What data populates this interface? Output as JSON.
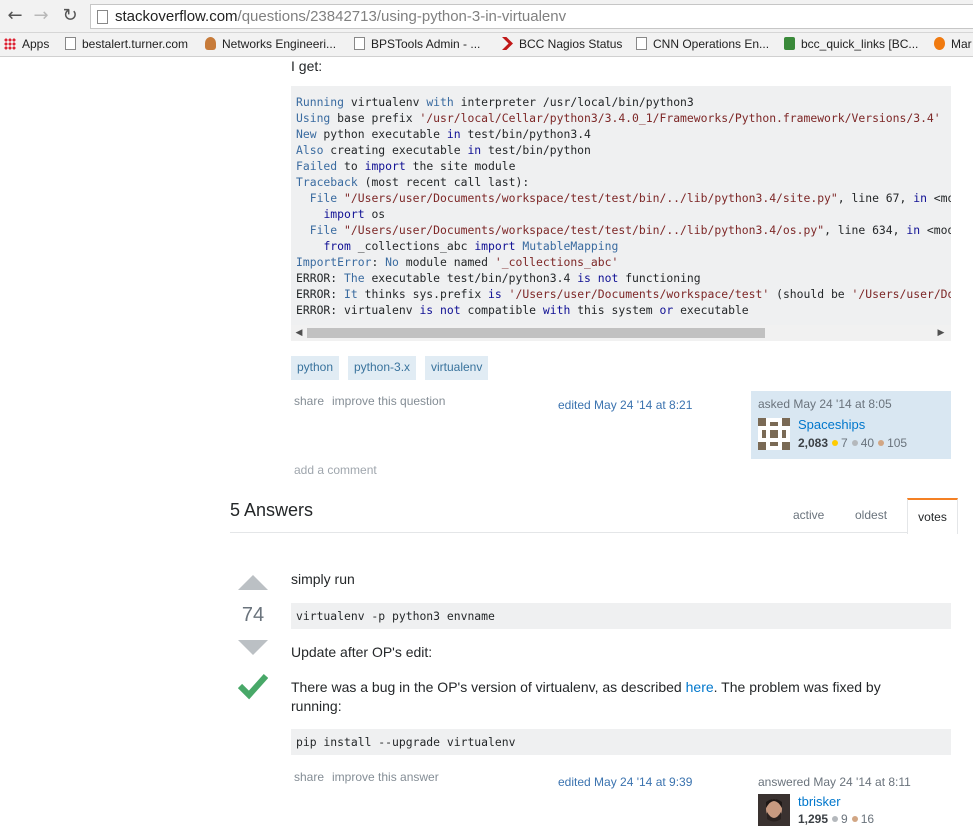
{
  "browser": {
    "url_host": "stackoverflow.com",
    "url_path": "/questions/23842713/using-python-3-in-virtualenv",
    "bookmarks": [
      "Apps",
      "bestalert.turner.com",
      "Networks Engineeri...",
      "BPSTools Admin - ...",
      "BCC Nagios Status",
      "CNN Operations En...",
      "bcc_quick_links [BC...",
      "Mar"
    ]
  },
  "question": {
    "i_get": "I get:",
    "code_lines": [
      [
        [
          "kb",
          "Running"
        ],
        [
          "t",
          " virtualenv "
        ],
        [
          "kb",
          "with"
        ],
        [
          "t",
          " interpreter /usr/local/bin/python3"
        ]
      ],
      [
        [
          "kb",
          "Using"
        ],
        [
          "t",
          " base prefix "
        ],
        [
          "st",
          "'/usr/local/Cellar/python3/3.4.0_1/Frameworks/Python.framework/Versions/3.4'"
        ]
      ],
      [
        [
          "kb",
          "New"
        ],
        [
          "t",
          " python executable "
        ],
        [
          "kw",
          "in"
        ],
        [
          "t",
          " test/bin/python3.4"
        ]
      ],
      [
        [
          "kb",
          "Also"
        ],
        [
          "t",
          " creating executable "
        ],
        [
          "kw",
          "in"
        ],
        [
          "t",
          " test/bin/python"
        ]
      ],
      [
        [
          "kb",
          "Failed"
        ],
        [
          "t",
          " to "
        ],
        [
          "kw",
          "import"
        ],
        [
          "t",
          " the site module"
        ]
      ],
      [
        [
          "kb",
          "Traceback"
        ],
        [
          "t",
          " (most recent call last):"
        ]
      ],
      [
        [
          "t",
          "  "
        ],
        [
          "kb",
          "File"
        ],
        [
          "t",
          " "
        ],
        [
          "st",
          "\"/Users/user/Documents/workspace/test/test/bin/../lib/python3.4/site.py\""
        ],
        [
          "t",
          ", line 67, "
        ],
        [
          "kw",
          "in"
        ],
        [
          "t",
          " <module>"
        ]
      ],
      [
        [
          "t",
          "    "
        ],
        [
          "kw",
          "import"
        ],
        [
          "t",
          " os"
        ]
      ],
      [
        [
          "t",
          "  "
        ],
        [
          "kb",
          "File"
        ],
        [
          "t",
          " "
        ],
        [
          "st",
          "\"/Users/user/Documents/workspace/test/test/bin/../lib/python3.4/os.py\""
        ],
        [
          "t",
          ", line 634, "
        ],
        [
          "kw",
          "in"
        ],
        [
          "t",
          " <module>"
        ]
      ],
      [
        [
          "t",
          "    "
        ],
        [
          "kw",
          "from"
        ],
        [
          "t",
          " _collections_abc "
        ],
        [
          "kw",
          "import"
        ],
        [
          "t",
          " "
        ],
        [
          "kb",
          "MutableMapping"
        ]
      ],
      [
        [
          "kb",
          "ImportError"
        ],
        [
          "t",
          ": "
        ],
        [
          "kb",
          "No"
        ],
        [
          "t",
          " module named "
        ],
        [
          "st",
          "'_collections_abc'"
        ]
      ],
      [
        [
          "t",
          "ERROR: "
        ],
        [
          "kb",
          "The"
        ],
        [
          "t",
          " executable test/bin/python3.4 "
        ],
        [
          "kw",
          "is"
        ],
        [
          "t",
          " "
        ],
        [
          "kw",
          "not"
        ],
        [
          "t",
          " functioning"
        ]
      ],
      [
        [
          "t",
          "ERROR: "
        ],
        [
          "kb",
          "It"
        ],
        [
          "t",
          " thinks sys.prefix "
        ],
        [
          "kw",
          "is"
        ],
        [
          "t",
          " "
        ],
        [
          "st",
          "'/Users/user/Documents/workspace/test'"
        ],
        [
          "t",
          " (should be "
        ],
        [
          "st",
          "'/Users/user/Documents/workspace/test/test'"
        ],
        [
          "t",
          ")"
        ]
      ],
      [
        [
          "t",
          "ERROR: virtualenv "
        ],
        [
          "kw",
          "is"
        ],
        [
          "t",
          " "
        ],
        [
          "kw",
          "not"
        ],
        [
          "t",
          " compatible "
        ],
        [
          "kw",
          "with"
        ],
        [
          "t",
          " this system "
        ],
        [
          "kw",
          "or"
        ],
        [
          "t",
          " executable"
        ]
      ]
    ],
    "tags": [
      "python",
      "python-3.x",
      "virtualenv"
    ],
    "share": "share",
    "improve": "improve this question",
    "edited": "edited May 24 '14 at 8:21",
    "asked": "asked May 24 '14 at 8:05",
    "user": {
      "name": "Spaceships",
      "rep": "2,083",
      "gold": "7",
      "silver": "40",
      "bronze": "105"
    },
    "add_comment": "add a comment"
  },
  "answers_header": {
    "title": "5 Answers",
    "tabs": [
      "active",
      "oldest",
      "votes"
    ]
  },
  "answer": {
    "votes": "74",
    "p1": "simply run",
    "code1": "virtualenv -p python3 envname",
    "p2": "Update after OP's edit:",
    "p3_before": "There was a bug in the OP's version of virtualenv, as described ",
    "p3_link": "here",
    "p3_after": ". The problem was fixed by running:",
    "code2": "pip install --upgrade virtualenv",
    "share": "share",
    "improve": "improve this answer",
    "edited": "edited May 24 '14 at 9:39",
    "answered": "answered May 24 '14 at 8:11",
    "user": {
      "name": "tbrisker",
      "rep": "1,295",
      "silver": "9",
      "bronze": "16"
    }
  },
  "colors": {
    "accent": "#f48024",
    "link": "#0077cc",
    "tag_bg": "#e1ecf4",
    "accepted": "#48a868"
  }
}
